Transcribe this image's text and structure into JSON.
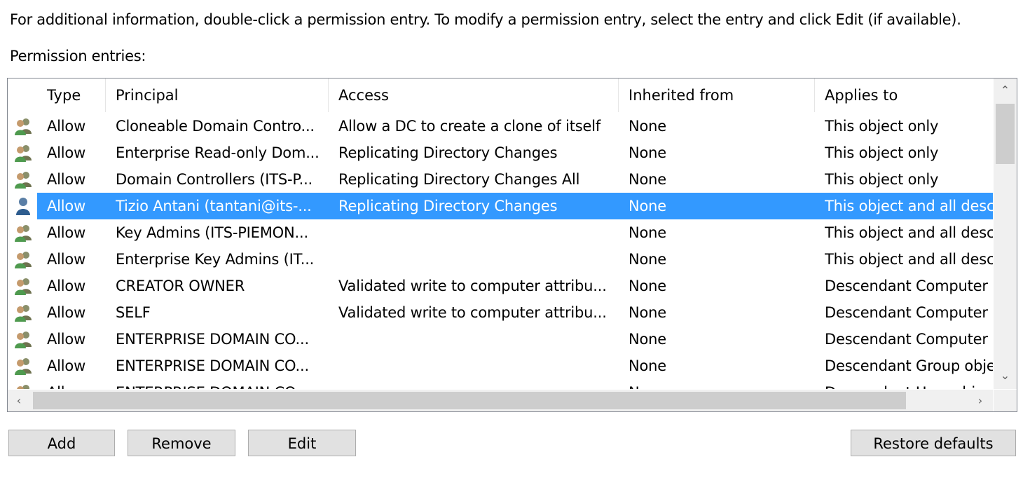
{
  "info_text": "For additional information, double-click a permission entry. To modify a permission entry, select the entry and click Edit (if available).",
  "entries_label": "Permission entries:",
  "columns": [
    "Type",
    "Principal",
    "Access",
    "Inherited from",
    "Applies to"
  ],
  "rows": [
    {
      "icon": "group-icon",
      "type": "Allow",
      "principal": "Cloneable Domain Contro...",
      "access": "Allow a DC to create a clone of itself",
      "inherited": "None",
      "applies": "This object only"
    },
    {
      "icon": "group-icon",
      "type": "Allow",
      "principal": "Enterprise Read-only Dom...",
      "access": "Replicating Directory Changes",
      "inherited": "None",
      "applies": "This object only"
    },
    {
      "icon": "group-icon",
      "type": "Allow",
      "principal": "Domain Controllers (ITS-P...",
      "access": "Replicating Directory Changes All",
      "inherited": "None",
      "applies": "This object only"
    },
    {
      "icon": "user-icon",
      "type": "Allow",
      "principal": "Tizio Antani (tantani@its-...",
      "access": "Replicating Directory Changes",
      "inherited": "None",
      "applies": "This object and all desc"
    },
    {
      "icon": "group-icon",
      "type": "Allow",
      "principal": "Key Admins (ITS-PIEMON...",
      "access": "",
      "inherited": "None",
      "applies": "This object and all desc"
    },
    {
      "icon": "group-icon",
      "type": "Allow",
      "principal": "Enterprise Key Admins (IT...",
      "access": "",
      "inherited": "None",
      "applies": "This object and all desc"
    },
    {
      "icon": "group-icon",
      "type": "Allow",
      "principal": "CREATOR OWNER",
      "access": "Validated write to computer attribu...",
      "inherited": "None",
      "applies": "Descendant Computer"
    },
    {
      "icon": "group-icon",
      "type": "Allow",
      "principal": "SELF",
      "access": "Validated write to computer attribu...",
      "inherited": "None",
      "applies": "Descendant Computer"
    },
    {
      "icon": "group-icon",
      "type": "Allow",
      "principal": "ENTERPRISE DOMAIN CO...",
      "access": "",
      "inherited": "None",
      "applies": "Descendant Computer"
    },
    {
      "icon": "group-icon",
      "type": "Allow",
      "principal": "ENTERPRISE DOMAIN CO...",
      "access": "",
      "inherited": "None",
      "applies": "Descendant Group obje"
    },
    {
      "icon": "group-icon",
      "type": "Allow",
      "principal": "ENTERPRISE DOMAIN CO...",
      "access": "",
      "inherited": "None",
      "applies": "Descendant User obje"
    }
  ],
  "selected_row": 3,
  "buttons": {
    "add": "Add",
    "remove": "Remove",
    "edit": "Edit",
    "restore": "Restore defaults"
  },
  "colors": {
    "selection": "#3399ff",
    "button_bg": "#e1e1e1",
    "scrollbar_thumb": "#cdcdcd"
  }
}
